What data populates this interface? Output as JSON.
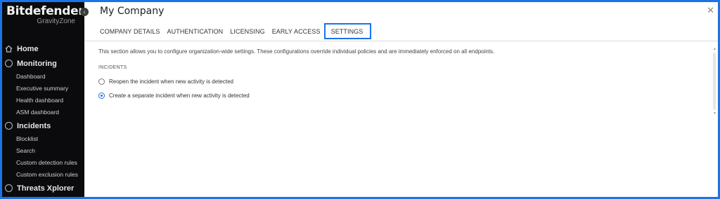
{
  "brand": {
    "name": "Bitdefender",
    "sub": "GravityZone"
  },
  "sidebar": {
    "groups": [
      {
        "label": "Home",
        "icon": "home-icon",
        "items": []
      },
      {
        "label": "Monitoring",
        "icon": "monitoring-icon",
        "items": [
          "Dashboard",
          "Executive summary",
          "Health dashboard",
          "ASM dashboard"
        ]
      },
      {
        "label": "Incidents",
        "icon": "incidents-icon",
        "items": [
          "Blocklist",
          "Search",
          "Custom detection rules",
          "Custom exclusion rules"
        ]
      },
      {
        "label": "Threats Xplorer",
        "icon": "threats-icon",
        "items": []
      }
    ]
  },
  "dialog": {
    "title": "My Company",
    "tabs": [
      "COMPANY DETAILS",
      "AUTHENTICATION",
      "LICENSING",
      "EARLY ACCESS",
      "SETTINGS"
    ],
    "active_tab": "SETTINGS",
    "description": "This section allows you to configure organization-wide settings. These configurations override individual policies and are immediately enforced on all endpoints.",
    "section_label": "INCIDENTS",
    "options": [
      {
        "label": "Reopen the incident when new activity is detected",
        "checked": false
      },
      {
        "label": "Create a separate incident when new activity is detected",
        "checked": true
      }
    ]
  },
  "colors": {
    "accent": "#1a73e8",
    "sidebar_bg": "#0b0b0d"
  }
}
